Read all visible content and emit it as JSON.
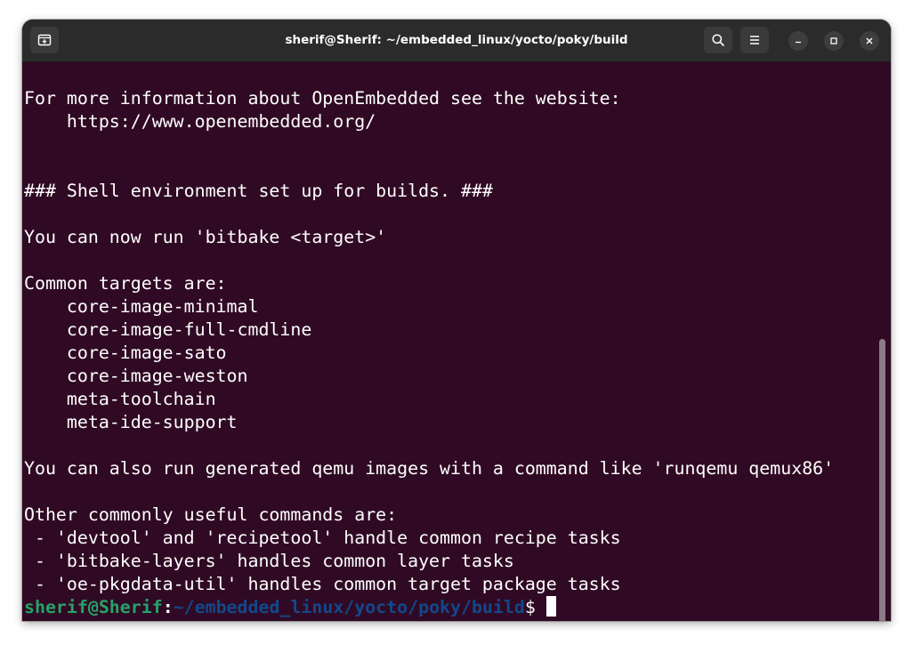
{
  "window": {
    "title": "sherif@Sherif: ~/embedded_linux/yocto/poky/build"
  },
  "titlebar": {
    "icons": [
      "new-tab-icon",
      "search-icon",
      "hamburger-menu-icon",
      "minimize-icon",
      "maximize-icon",
      "close-icon"
    ]
  },
  "terminal": {
    "lines": [
      "For more information about OpenEmbedded see the website:",
      "    https://www.openembedded.org/",
      "",
      "",
      "### Shell environment set up for builds. ###",
      "",
      "You can now run 'bitbake <target>'",
      "",
      "Common targets are:",
      "    core-image-minimal",
      "    core-image-full-cmdline",
      "    core-image-sato",
      "    core-image-weston",
      "    meta-toolchain",
      "    meta-ide-support",
      "",
      "You can also run generated qemu images with a command like 'runqemu qemux86'",
      "",
      "Other commonly useful commands are:",
      " - 'devtool' and 'recipetool' handle common recipe tasks",
      " - 'bitbake-layers' handles common layer tasks",
      " - 'oe-pkgdata-util' handles common target package tasks"
    ],
    "prompt": {
      "user_host": "sherif@Sherif",
      "colon": ":",
      "path": "~/embedded_linux/yocto/poky/build",
      "symbol": "$"
    }
  },
  "colors": {
    "terminal_bg": "#300a24",
    "titlebar_bg": "#2b2b2b",
    "prompt_user": "#26a269",
    "prompt_path": "#12488b",
    "text": "#ffffff"
  }
}
